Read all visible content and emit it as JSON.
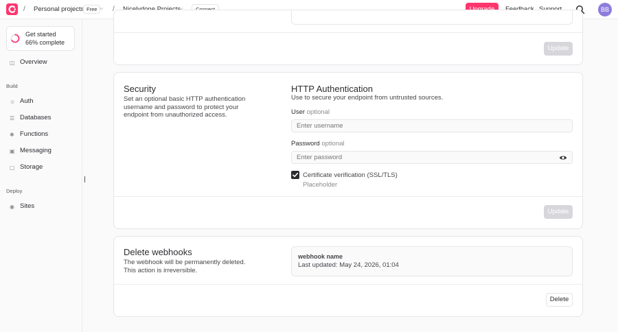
{
  "topbar": {
    "org_name": "Personal projects",
    "plan_badge": "Free",
    "project_name": "Nicelydone Projects",
    "connect_label": "Connect",
    "upgrade_label": "Upgrade",
    "feedback_label": "Feedback",
    "support_label": "Support",
    "avatar_initials": "BB",
    "accent_color": "#fd366e"
  },
  "sidebar": {
    "progress": {
      "line1": "Get started",
      "line2": "66% complete",
      "value": 0.66
    },
    "overview": "Overview",
    "build_section": "Build",
    "build_items": [
      "Auth",
      "Databases",
      "Functions",
      "Messaging",
      "Storage"
    ],
    "deploy_section": "Deploy",
    "deploy_items": [
      "Sites"
    ]
  },
  "top_card": {
    "update_label": "Update"
  },
  "security": {
    "title": "Security",
    "description": "Set an optional basic HTTP authentication username and password to protect your endpoint from unauthorized access.",
    "http_title": "HTTP Authentication",
    "http_subtitle": "Use to secure your endpoint from untrusted sources.",
    "user_label": "User",
    "user_optional": "optional",
    "user_placeholder": "Enter username",
    "password_label": "Password",
    "password_optional": "optional",
    "password_placeholder": "Enter password",
    "cert_label": "Certificate verification (SSL/TLS)",
    "cert_desc": "Placeholder",
    "update_label": "Update"
  },
  "delete": {
    "title": "Delete webhooks",
    "description": "The webhook will be permanently deleted. This action is irreversible.",
    "webhook_name": "webhook name",
    "last_updated": "Last updated: May 24, 2026, 01:04",
    "delete_label": "Delete"
  }
}
